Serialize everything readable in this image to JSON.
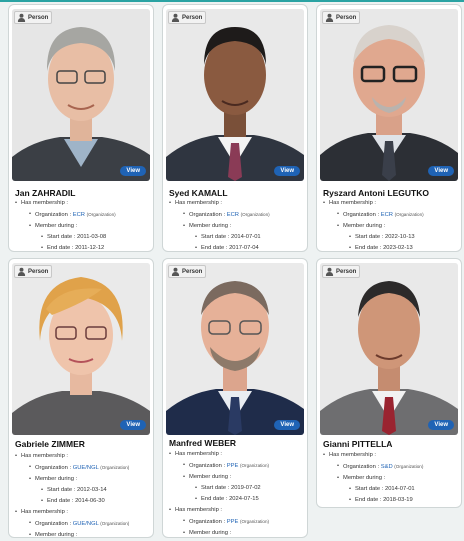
{
  "labels": {
    "badge": "Person",
    "view": "View",
    "has_membership": "Has membership :",
    "organization": "Organization :",
    "member_during": "Member during :",
    "start_date": "Start date :",
    "end_date": "End date :",
    "org_note": "(Organization)"
  },
  "colors": {
    "accent": "#1f63b5",
    "teal": "#2aa3a3"
  },
  "cards": [
    {
      "name": "Jan ZAHRADIL",
      "memberships": [
        {
          "org": "ECR",
          "start": "2011-03-08",
          "end": "2011-12-12"
        }
      ]
    },
    {
      "name": "Syed KAMALL",
      "memberships": [
        {
          "org": "ECR",
          "start": "2014-07-01",
          "end": "2017-07-04"
        }
      ]
    },
    {
      "name": "Ryszard Antoni LEGUTKO",
      "memberships": [
        {
          "org": "ECR",
          "start": "2022-10-13",
          "end": "2023-02-13"
        }
      ]
    },
    {
      "name": "Gabriele ZIMMER",
      "memberships": [
        {
          "org": "GUE/NGL",
          "start": "2012-03-14",
          "end": "2014-06-30"
        },
        {
          "org": "GUE/NGL"
        }
      ]
    },
    {
      "name": "Manfred WEBER",
      "memberships": [
        {
          "org": "PPE",
          "start": "2019-07-02",
          "end": "2024-07-15"
        },
        {
          "org": "PPE"
        }
      ]
    },
    {
      "name": "Gianni PITTELLA",
      "memberships": [
        {
          "org": "S&D",
          "start": "2014-07-01",
          "end": "2018-03-19"
        }
      ]
    }
  ]
}
